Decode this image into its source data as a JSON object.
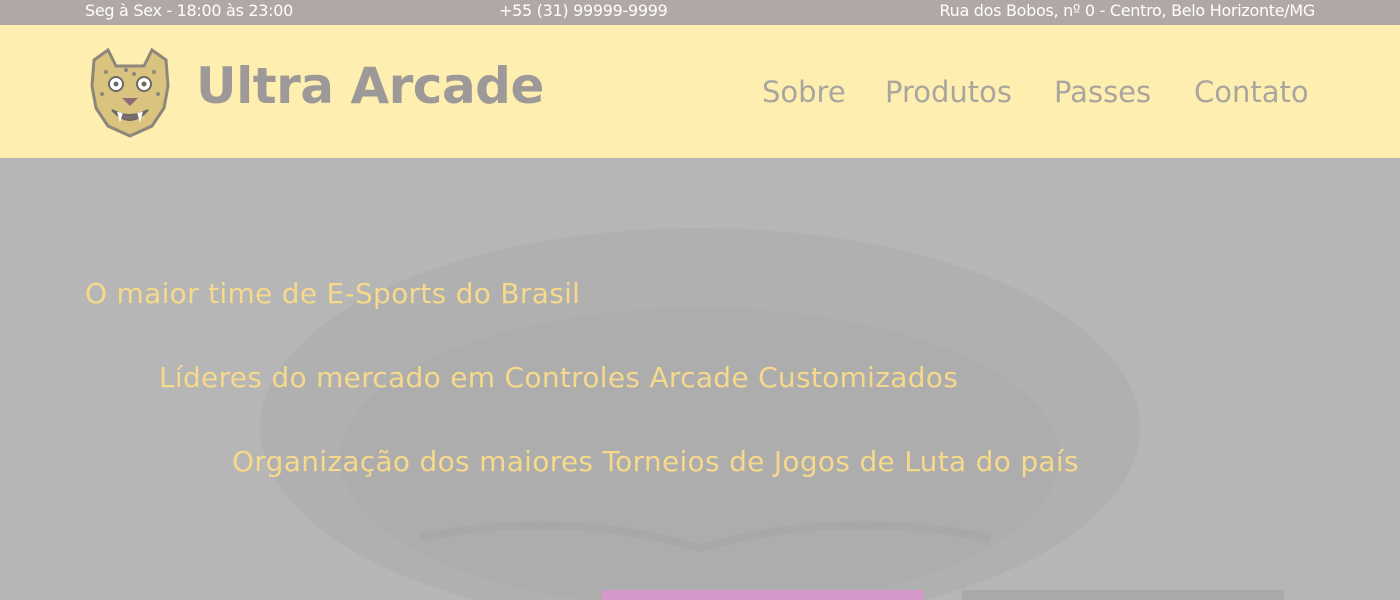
{
  "topbar": {
    "hours": "Seg à Sex - 18:00 às 23:00",
    "phone": "+55 (31) 99999-9999",
    "address": "Rua dos Bobos, nº 0 - Centro, Belo Horizonte/MG"
  },
  "header": {
    "brand": "Ultra Arcade",
    "logo_icon": "jaguar-head-icon",
    "nav": [
      "Sobre",
      "Produtos",
      "Passes",
      "Contato"
    ]
  },
  "hero": {
    "taglines": [
      "O maior time de E-Sports do Brasil",
      "Líderes do mercado em Controles Arcade Customizados",
      "Organização dos maiores Torneios de Jogos de Luta do país"
    ]
  },
  "colors": {
    "topbar_bg": "#b1a7a5",
    "header_bg": "#feeeb0",
    "hero_bg": "#b6b6b6",
    "tagline": "#f6d98a",
    "brand_text": "#9d9998"
  }
}
